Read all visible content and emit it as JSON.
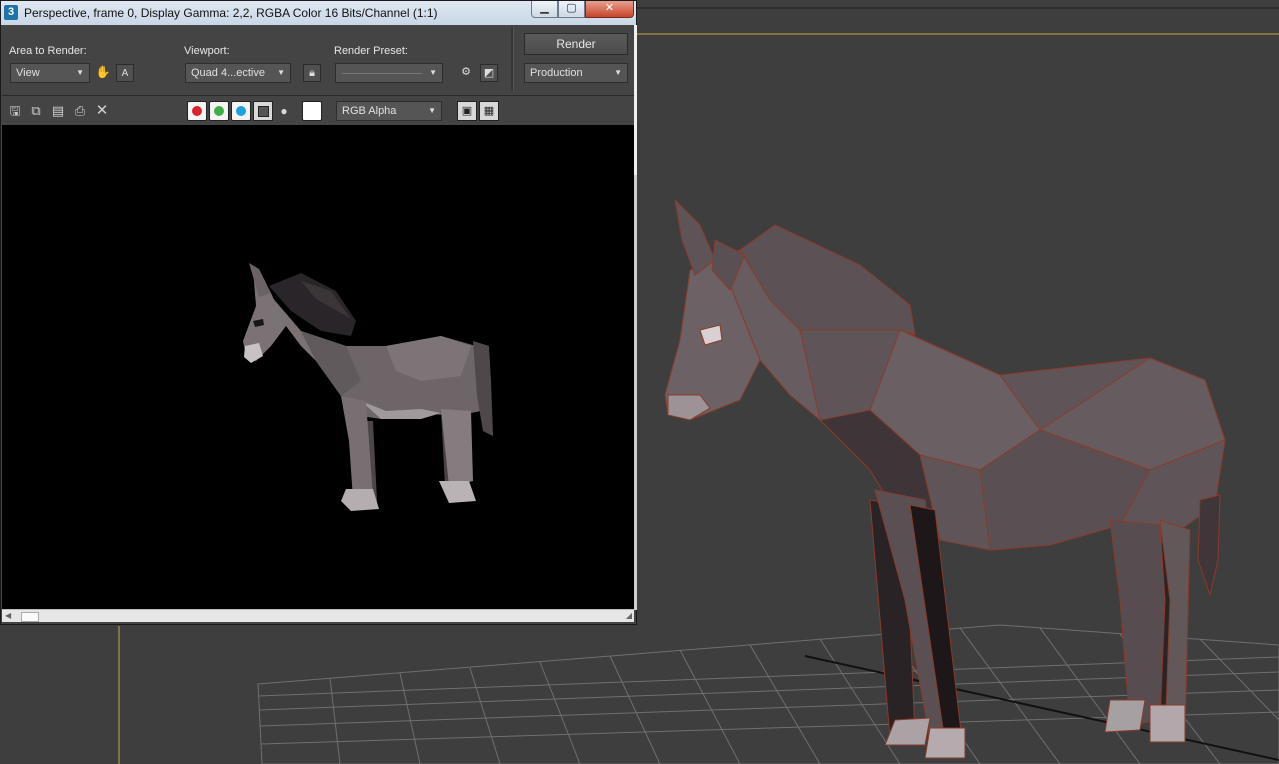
{
  "window": {
    "app_icon": "3",
    "title": "Perspective, frame 0, Display Gamma: 2,2, RGBA Color 16 Bits/Channel (1:1)",
    "controls": [
      "minimize-icon",
      "maximize-icon",
      "close-icon"
    ]
  },
  "settings": {
    "area_to_render_label": "Area to Render:",
    "area_to_render_value": "View",
    "viewport_label": "Viewport:",
    "viewport_value": "Quad 4...ective",
    "render_preset_label": "Render Preset:",
    "render_preset_value": "",
    "render_button_label": "Render",
    "render_mode_value": "Production"
  },
  "toolbar": {
    "tools": [
      "save-icon",
      "copy-icon",
      "clone-icon",
      "print-icon",
      "clear-icon"
    ],
    "channels": [
      {
        "name": "red",
        "color": "#d9232d"
      },
      {
        "name": "green",
        "color": "#3fae49"
      },
      {
        "name": "blue",
        "color": "#1ca0e0"
      }
    ],
    "channel_display_value": "RGB Alpha"
  },
  "render": {
    "subject": "donkey",
    "background": "#000000"
  },
  "viewport3d": {
    "subject": "donkey",
    "grid_color": "#6a6a6a",
    "edge_color": "#8a3a2a"
  }
}
